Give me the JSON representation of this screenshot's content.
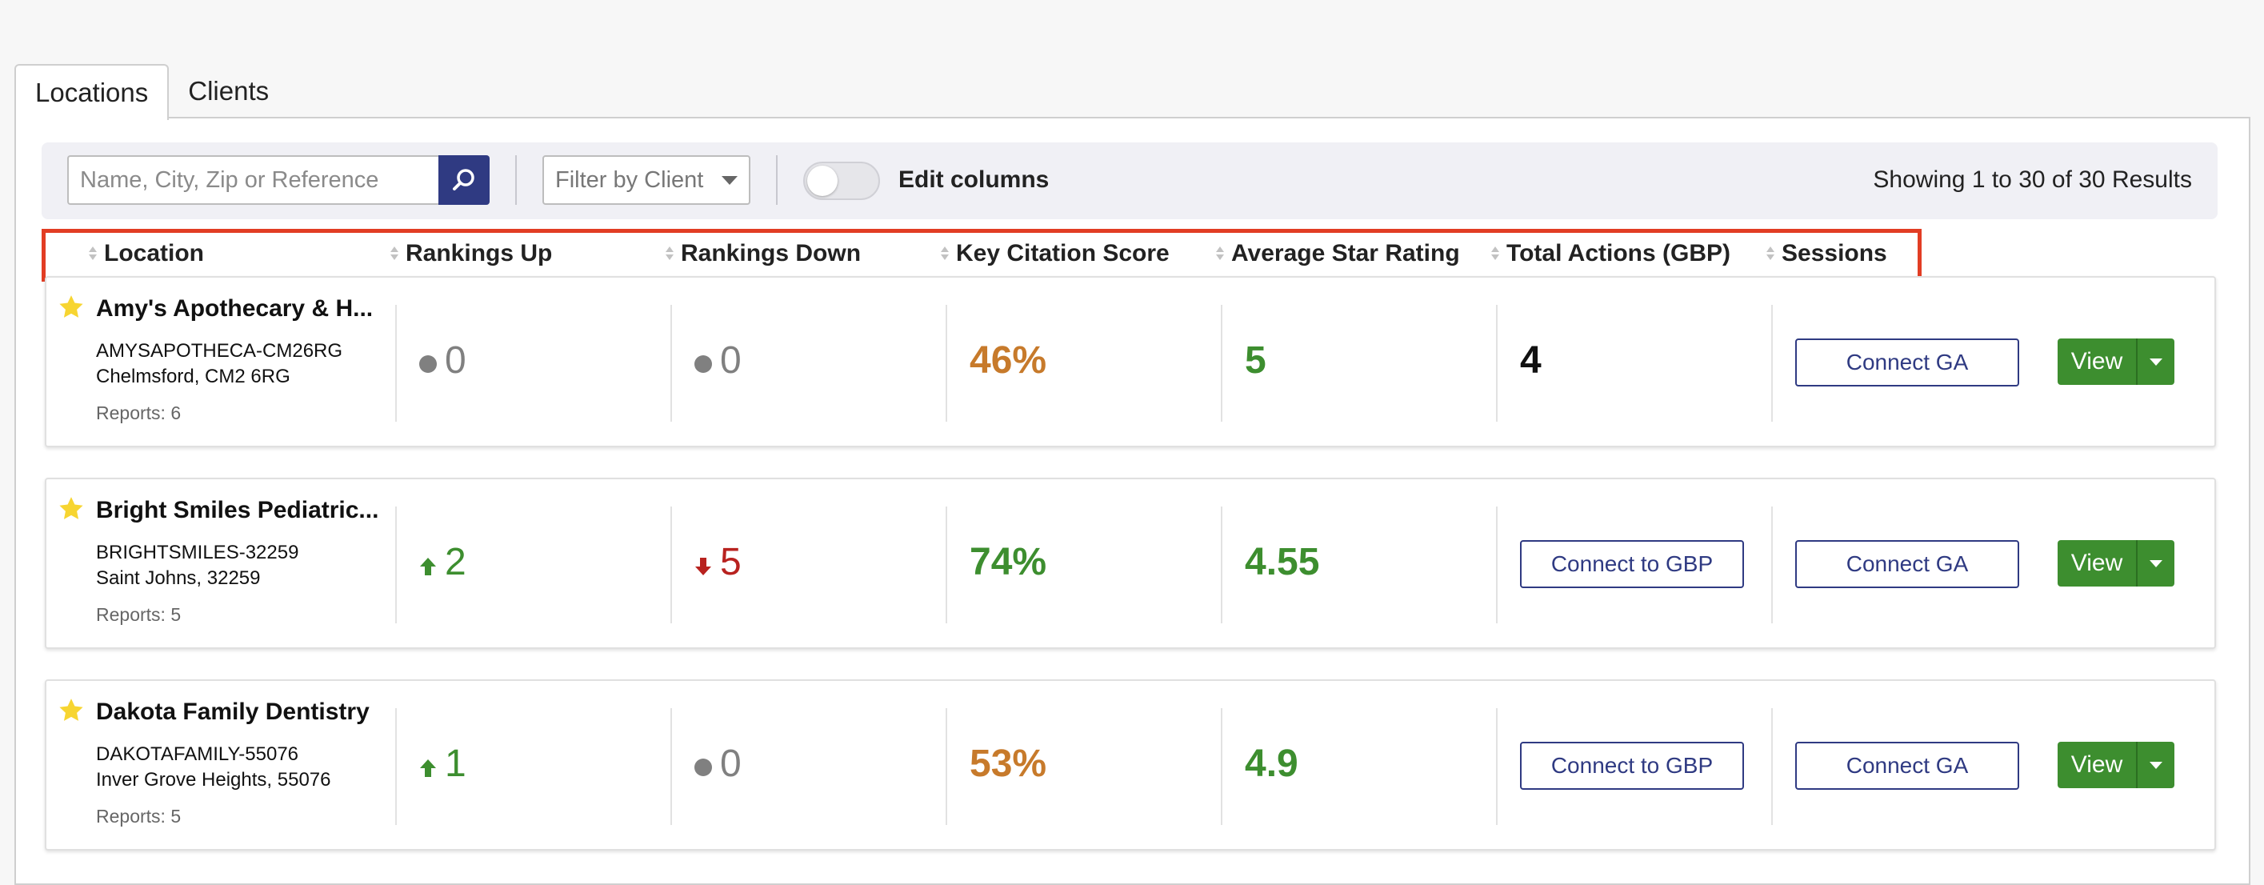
{
  "colors": {
    "accent_navy": "#2f3a82",
    "green": "#3d8e2f",
    "orange": "#c77a2b",
    "red": "#b8221f",
    "gray": "#808080",
    "highlight_border": "#e23d24",
    "star_yellow": "#f7d531"
  },
  "tabs": [
    {
      "label": "Locations",
      "active": true
    },
    {
      "label": "Clients",
      "active": false
    }
  ],
  "toolbar": {
    "search_placeholder": "Name, City, Zip or Reference",
    "search_icon": "search-icon",
    "client_filter_label": "Filter by Client",
    "edit_columns_label": "Edit columns",
    "edit_columns_on": false,
    "results_text": "Showing 1 to 30 of 30 Results"
  },
  "columns": [
    "Location",
    "Rankings Up",
    "Rankings Down",
    "Key Citation Score",
    "Average Star Rating",
    "Total Actions (GBP)",
    "Sessions"
  ],
  "rows": [
    {
      "name": "Amy's Apothecary & H...",
      "reference": "AMYSAPOTHECA-CM26RG",
      "city": "Chelmsford, CM2 6RG",
      "reports": "Reports: 6",
      "rankings_up": {
        "value": "0",
        "trend": "neutral"
      },
      "rankings_down": {
        "value": "0",
        "trend": "neutral"
      },
      "citation_score": {
        "value": "46%",
        "tone": "orange"
      },
      "star_rating": "5",
      "total_actions": "4",
      "connect_gbp": null,
      "connect_ga": "Connect GA",
      "view_label": "View"
    },
    {
      "name": "Bright Smiles Pediatric...",
      "reference": "BRIGHTSMILES-32259",
      "city": "Saint Johns, 32259",
      "reports": "Reports: 5",
      "rankings_up": {
        "value": "2",
        "trend": "up"
      },
      "rankings_down": {
        "value": "5",
        "trend": "down"
      },
      "citation_score": {
        "value": "74%",
        "tone": "green"
      },
      "star_rating": "4.55",
      "total_actions": null,
      "connect_gbp": "Connect to GBP",
      "connect_ga": "Connect GA",
      "view_label": "View"
    },
    {
      "name": "Dakota Family Dentistry",
      "reference": "DAKOTAFAMILY-55076",
      "city": "Inver Grove Heights, 55076",
      "reports": "Reports: 5",
      "rankings_up": {
        "value": "1",
        "trend": "up"
      },
      "rankings_down": {
        "value": "0",
        "trend": "neutral"
      },
      "citation_score": {
        "value": "53%",
        "tone": "orange"
      },
      "star_rating": "4.9",
      "total_actions": null,
      "connect_gbp": "Connect to GBP",
      "connect_ga": "Connect GA",
      "view_label": "View"
    }
  ]
}
